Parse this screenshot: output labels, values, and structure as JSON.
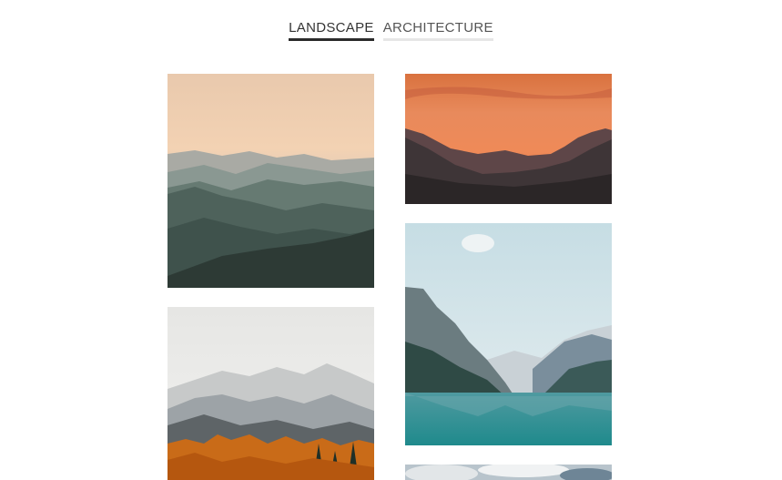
{
  "filters": {
    "tabs": [
      {
        "label": "LANDSCAPE",
        "active": true
      },
      {
        "label": "ARCHITECTURE",
        "active": false
      }
    ]
  },
  "gallery": {
    "photos": [
      {
        "subject": "misty mountain ridges at sunset"
      },
      {
        "subject": "orange sky over rocky peaks"
      },
      {
        "subject": "turquoise lake between mountains"
      },
      {
        "subject": "snowy peaks with autumn trees"
      },
      {
        "subject": "clouds over mountains"
      }
    ]
  },
  "colors": {
    "tab_active_underline": "#2b2b2b",
    "tab_inactive_underline": "#e6e6e6",
    "background": "#ffffff"
  }
}
